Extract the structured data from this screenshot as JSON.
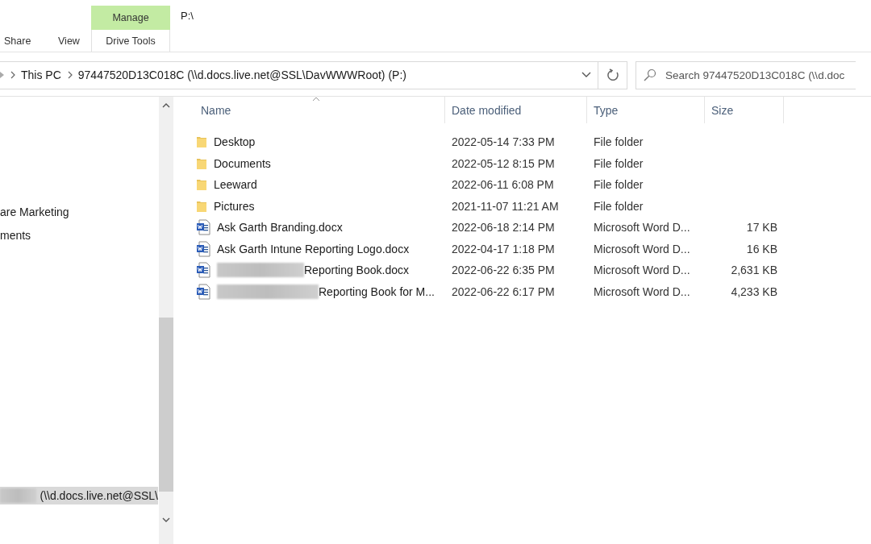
{
  "ribbon": {
    "tabs": [
      {
        "label": "Share",
        "selected": false
      },
      {
        "label": "View",
        "selected": false
      }
    ],
    "contextual": {
      "group": "Manage",
      "tab": {
        "label": "Drive Tools",
        "selected": false
      }
    },
    "title": "P:\\"
  },
  "address": {
    "crumbs": [
      "This PC",
      "97447520D13C018C (\\\\d.docs.live.net@SSL\\DavWWWRoot) (P:)"
    ]
  },
  "search": {
    "placeholder": "Search 97447520D13C018C (\\\\d.doc"
  },
  "nav": {
    "items": [
      {
        "label": "are Marketing",
        "selected": false,
        "redacted": false
      },
      {
        "label": "ments",
        "selected": false,
        "redacted": false
      },
      {
        "label": "(\\\\d.docs.live.net@SSL\\",
        "selected": true,
        "redacted": true
      }
    ]
  },
  "table": {
    "columns": [
      "Name",
      "Date modified",
      "Type",
      "Size"
    ],
    "rows": [
      {
        "kind": "folder",
        "name": "Desktop",
        "redacted": false,
        "date": "2022-05-14 7:33 PM",
        "type": "File folder",
        "size": ""
      },
      {
        "kind": "folder",
        "name": "Documents",
        "redacted": false,
        "date": "2022-05-12 8:15 PM",
        "type": "File folder",
        "size": ""
      },
      {
        "kind": "folder",
        "name": "Leeward",
        "redacted": false,
        "date": "2022-06-11 6:08 PM",
        "type": "File folder",
        "size": ""
      },
      {
        "kind": "folder",
        "name": "Pictures",
        "redacted": false,
        "date": "2021-11-07 11:21 AM",
        "type": "File folder",
        "size": ""
      },
      {
        "kind": "word",
        "name": "Ask Garth Branding.docx",
        "redacted": false,
        "date": "2022-06-18 2:14 PM",
        "type": "Microsoft Word D...",
        "size": "17 KB"
      },
      {
        "kind": "word",
        "name": "Ask Garth Intune Reporting Logo.docx",
        "redacted": false,
        "date": "2022-04-17 1:18 PM",
        "type": "Microsoft Word D...",
        "size": "16 KB"
      },
      {
        "kind": "word",
        "name": "Reporting Book.docx",
        "redacted": true,
        "date": "2022-06-22 6:35 PM",
        "type": "Microsoft Word D...",
        "size": "2,631 KB"
      },
      {
        "kind": "word",
        "name": "Reporting Book for M...",
        "redacted": true,
        "date": "2022-06-22 6:17 PM",
        "type": "Microsoft Word D...",
        "size": "4,233 KB"
      }
    ]
  }
}
